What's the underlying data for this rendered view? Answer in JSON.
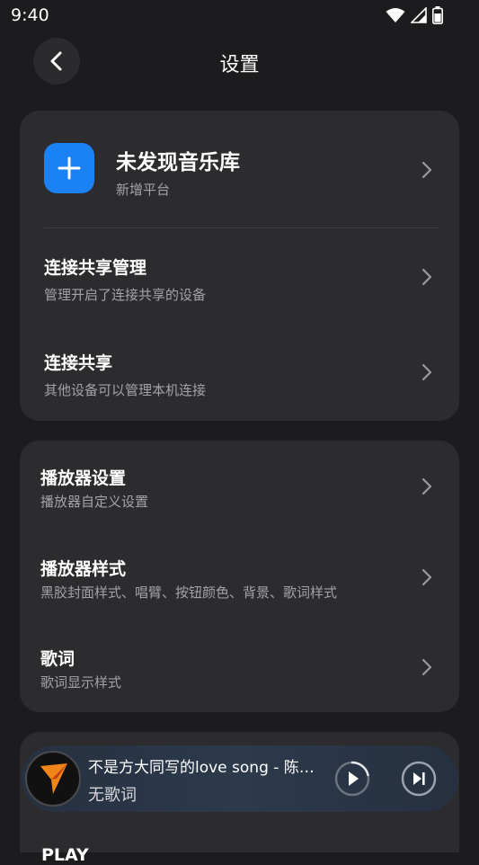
{
  "status_bar": {
    "time": "9:40"
  },
  "header": {
    "title": "设置",
    "back_icon": "chevron-left-icon"
  },
  "section1": {
    "library": {
      "title": "未发现音乐库",
      "subtitle": "新增平台",
      "icon": "plus-icon",
      "accent": "#1a82f5"
    },
    "items": [
      {
        "title": "连接共享管理",
        "subtitle": "管理开启了连接共享的设备"
      },
      {
        "title": "连接共享",
        "subtitle": "其他设备可以管理本机连接"
      }
    ]
  },
  "section2": {
    "items": [
      {
        "title": "播放器设置",
        "subtitle": "播放器自定义设置"
      },
      {
        "title": "播放器样式",
        "subtitle": "黑胶封面样式、唱臂、按钮颜色、背景、歌词样式"
      },
      {
        "title": "歌词",
        "subtitle": "歌词显示样式"
      }
    ]
  },
  "section3": {
    "partial_title": "PLAY"
  },
  "mini_player": {
    "song": "不是方大同写的love song - 陈…",
    "lyric": "无歌词",
    "play_icon": "play-icon",
    "next_icon": "skip-next-icon"
  }
}
